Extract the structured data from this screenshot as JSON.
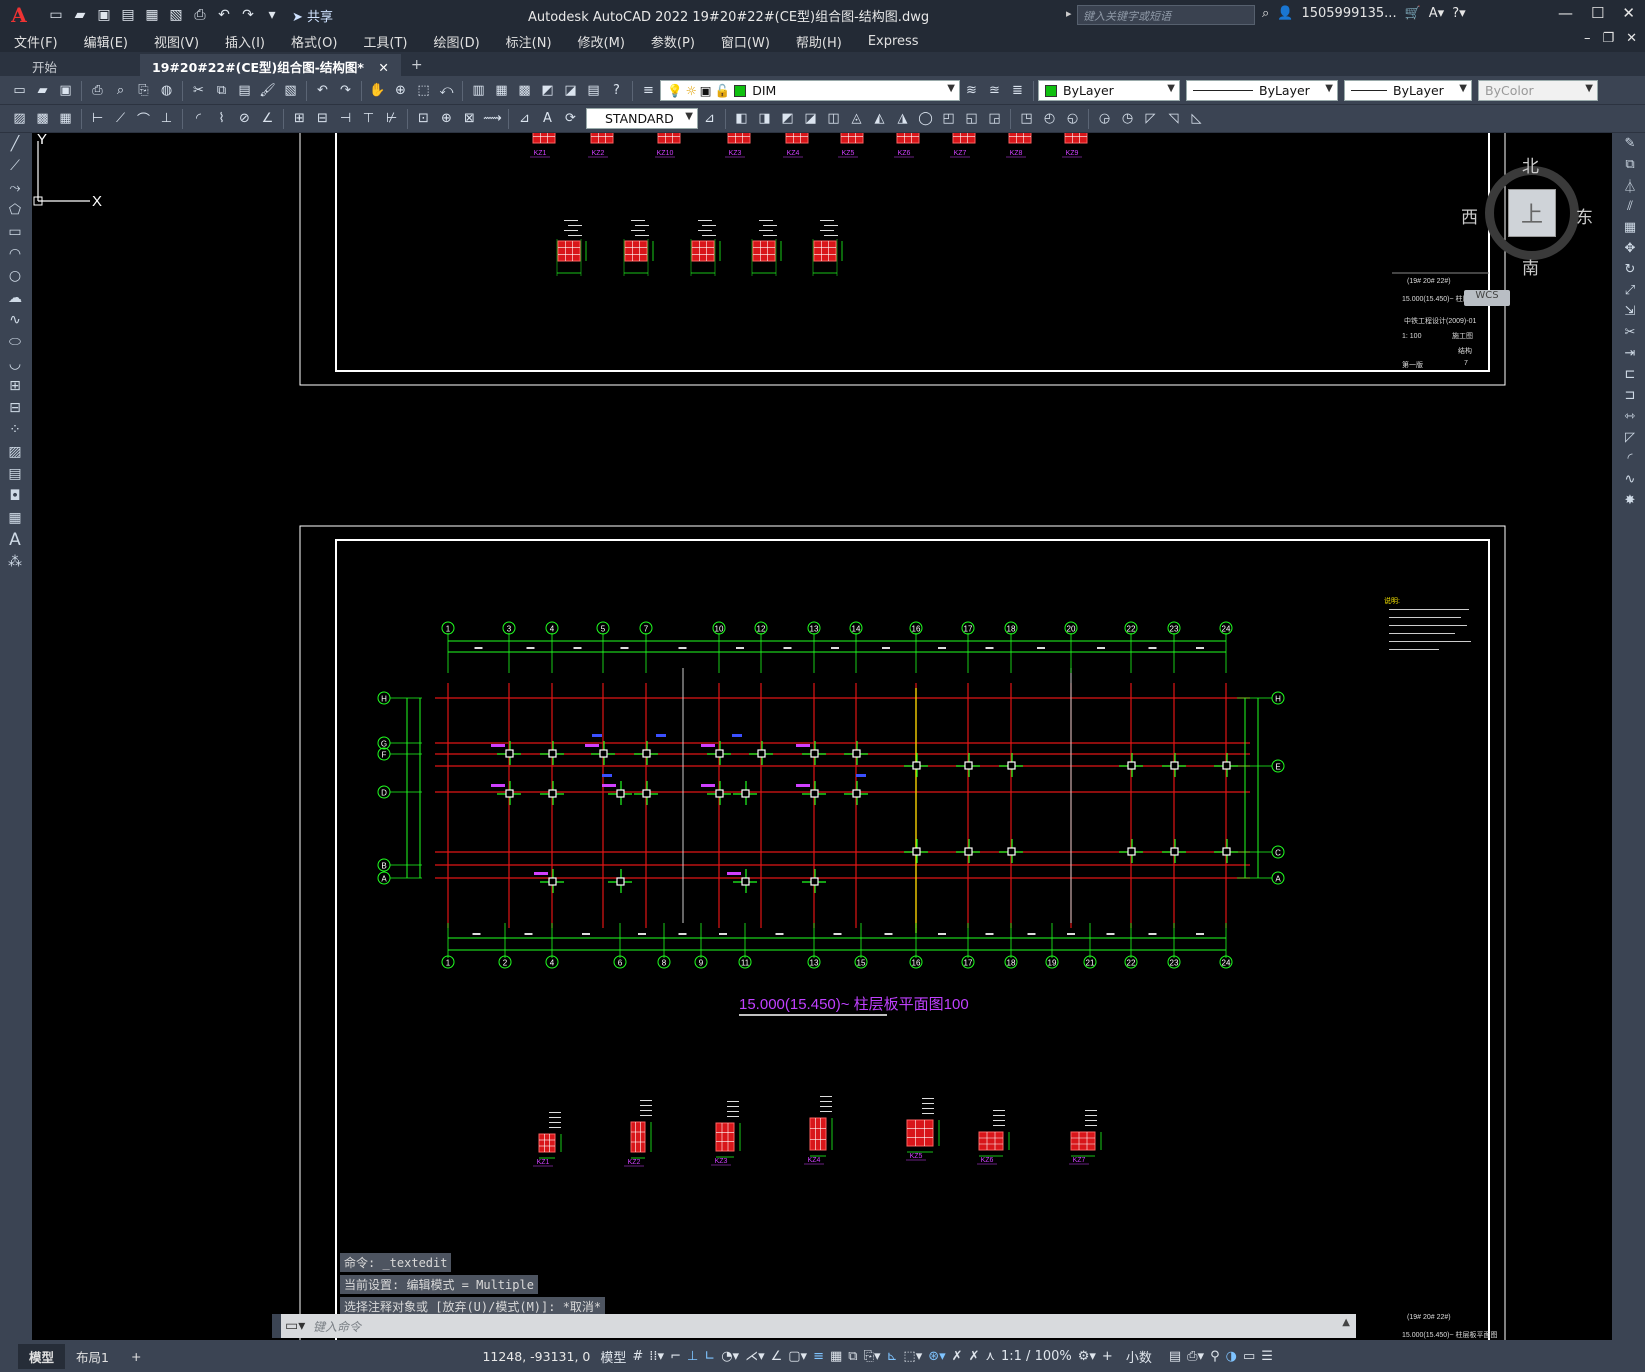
{
  "titlebar": {
    "logo": "A",
    "share_label": "共享",
    "title": "Autodesk AutoCAD 2022    19#20#22#(CE型)组合图-结构图.dwg",
    "search_placeholder": "键入关键字或短语",
    "user": "1505999135...",
    "qat_icons": [
      "new-icon",
      "open-icon",
      "save-icon",
      "saveas-icon",
      "web-open-icon",
      "web-save-icon",
      "plot-icon",
      "undo-icon",
      "redo-icon",
      "customize-icon"
    ]
  },
  "menu": [
    "文件(F)",
    "编辑(E)",
    "视图(V)",
    "插入(I)",
    "格式(O)",
    "工具(T)",
    "绘图(D)",
    "标注(N)",
    "修改(M)",
    "参数(P)",
    "窗口(W)",
    "帮助(H)",
    "Express"
  ],
  "tabs": {
    "start": "开始",
    "active": "19#20#22#(CE型)组合图-结构图*",
    "close": "✕",
    "add": "+"
  },
  "properties": {
    "layer": "DIM",
    "color": "ByLayer",
    "linetype": "ByLayer",
    "lineweight": "ByLayer",
    "plotstyle": "ByColor",
    "text_style": "STANDARD",
    "layer_color": "#10c010",
    "color_swatch": "#10c010"
  },
  "viewcube": {
    "north": "北",
    "south": "南",
    "east": "东",
    "west": "西",
    "face": "上",
    "wcs": "WCS"
  },
  "drawing": {
    "plan_title": "15.000(15.450)~  柱层板平面图100",
    "sheet_top": {
      "title_block_lines": [
        "(19# 20# 22#)",
        "15.000(15.450)~ 柱层板平面图",
        "中铁工程设计(2009)-01",
        "1: 100",
        "施工图",
        "结构",
        "第一版",
        "7"
      ]
    },
    "sheet_bottom_title": "(19# 20# 22#)",
    "top_column_labels": [
      "KZ1",
      "KZ2",
      "KZ10",
      "KZ3",
      "KZ4",
      "KZ5",
      "KZ6",
      "KZ7",
      "KZ8",
      "KZ9"
    ],
    "bottom_column_labels": [
      "KZ1",
      "KZ2",
      "KZ3",
      "KZ4",
      "KZ5",
      "KZ6",
      "KZ7"
    ],
    "axis_top": [
      "1",
      "3",
      "4",
      "5",
      "7",
      "10",
      "12",
      "13",
      "14",
      "16",
      "17",
      "18",
      "20",
      "22",
      "23",
      "24"
    ],
    "axis_bottom": [
      "1",
      "2",
      "4",
      "6",
      "8",
      "9",
      "11",
      "13",
      "15",
      "16",
      "17",
      "18",
      "19",
      "21",
      "22",
      "23",
      "24"
    ],
    "axis_left": [
      "H",
      "G",
      "F",
      "D",
      "B",
      "A"
    ],
    "axis_right": [
      "H",
      "E",
      "C",
      "A"
    ],
    "notes_header": "说明:"
  },
  "command": {
    "history": [
      "命令: _textedit",
      "当前设置: 编辑模式 = Multiple",
      "选择注释对象或 [放弃(U)/模式(M)]: *取消*"
    ],
    "placeholder": "键入命令"
  },
  "ucs": {
    "x": "X",
    "y": "Y"
  },
  "status": {
    "model_tab": "模型",
    "layout_tab": "布局1",
    "add": "+",
    "coords": "11248, -93131, 0",
    "space": "模型",
    "scale": "1:1 / 100%",
    "units": "小数"
  }
}
